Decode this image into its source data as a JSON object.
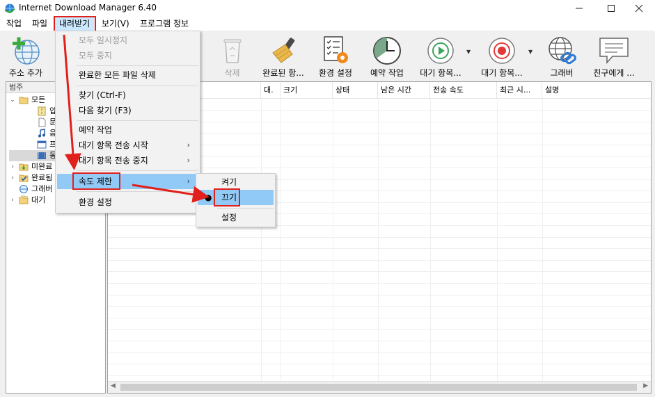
{
  "window": {
    "title": "Internet Download Manager 6.40"
  },
  "menubar": {
    "items": [
      {
        "label": "작업"
      },
      {
        "label": "파일"
      },
      {
        "label": "내려받기"
      },
      {
        "label": "보기(V)"
      },
      {
        "label": "프로그램 정보"
      }
    ]
  },
  "toolbar": {
    "buttons": [
      {
        "label": "주소 추가",
        "icon": "add-url-icon",
        "enabled": true
      },
      {
        "label": "삭제",
        "icon": "recycle-bin-icon",
        "enabled": false
      },
      {
        "label": "완료된 항...",
        "icon": "broom-icon",
        "enabled": true
      },
      {
        "label": "환경 설정",
        "icon": "settings-checklist-icon",
        "enabled": true
      },
      {
        "label": "예약 작업",
        "icon": "clock-icon",
        "enabled": true
      },
      {
        "label": "대기 항목...",
        "icon": "play-icon",
        "enabled": true
      },
      {
        "label": "대기 항목...",
        "icon": "record-stop-icon",
        "enabled": true
      },
      {
        "label": "그래버",
        "icon": "globe-link-icon",
        "enabled": true
      },
      {
        "label": "친구에게 ...",
        "icon": "speech-bubble-icon",
        "enabled": true
      }
    ]
  },
  "sidebar": {
    "header": "범주",
    "tree": [
      {
        "label": "모든",
        "level": 0,
        "expanded": true
      },
      {
        "label": "압",
        "level": 1
      },
      {
        "label": "문",
        "level": 1
      },
      {
        "label": "음",
        "level": 1
      },
      {
        "label": "프",
        "level": 1
      },
      {
        "label": "동",
        "level": 1
      },
      {
        "label": "미완료",
        "level": 0,
        "expanded": false
      },
      {
        "label": "완료됨",
        "level": 0,
        "expanded": false
      },
      {
        "label": "그래버",
        "level": 0
      },
      {
        "label": "대기",
        "level": 0,
        "expanded": false
      }
    ]
  },
  "list": {
    "columns": [
      {
        "label": ""
      },
      {
        "label": "대."
      },
      {
        "label": "크기"
      },
      {
        "label": "상태"
      },
      {
        "label": "남은 시간"
      },
      {
        "label": "전송 속도"
      },
      {
        "label": "최근 시..."
      },
      {
        "label": "설명"
      }
    ]
  },
  "download_menu": {
    "items": [
      {
        "label": "모두 일시정지",
        "enabled": false
      },
      {
        "label": "모두 중지",
        "enabled": false
      },
      {
        "label": "완료한 모든 파일 삭제",
        "enabled": true
      },
      {
        "label": "찾기 (Ctrl-F)",
        "enabled": true
      },
      {
        "label": "다음 찾기 (F3)",
        "enabled": true
      },
      {
        "label": "예약 작업",
        "enabled": true
      },
      {
        "label": "대기 항목 전송 시작",
        "enabled": true,
        "submenu": true
      },
      {
        "label": "대기 항목 전송 중지",
        "enabled": true,
        "submenu": true
      },
      {
        "label": "속도 제한",
        "enabled": true,
        "submenu": true,
        "selected": true
      },
      {
        "label": "환경 설정",
        "enabled": true
      }
    ],
    "submenu_glyph": "›"
  },
  "speed_limit_submenu": {
    "items": [
      {
        "label": "켜기",
        "checked": false
      },
      {
        "label": "끄기",
        "checked": true,
        "selected": true
      },
      {
        "label": "설정",
        "checked": false
      }
    ],
    "check_glyph": "●"
  },
  "colors": {
    "highlight": "#e0201c",
    "selection": "#91c9f7",
    "menu_active": "#cce8ff"
  }
}
